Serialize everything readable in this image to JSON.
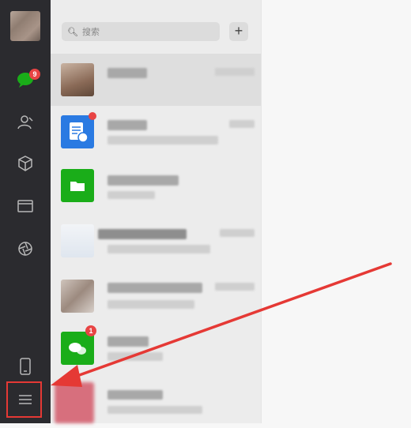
{
  "search": {
    "placeholder": "搜索"
  },
  "toolbar": {
    "add_label": "+"
  },
  "badges": {
    "chats": "9",
    "official_accounts": "1"
  },
  "colors": {
    "rail": "#2b2b2f",
    "list": "#ececec",
    "accent_green": "#1aad19",
    "doc_blue": "#2a7ae2",
    "badge_red": "#e84444",
    "annotation_red": "#e53935"
  },
  "icons": {
    "chats": "chat-bubble-icon",
    "contacts": "contacts-icon",
    "favorites": "cube-icon",
    "files": "folder-icon",
    "moments": "aperture-icon",
    "phone": "phone-icon",
    "menu": "hamburger-menu-icon"
  }
}
